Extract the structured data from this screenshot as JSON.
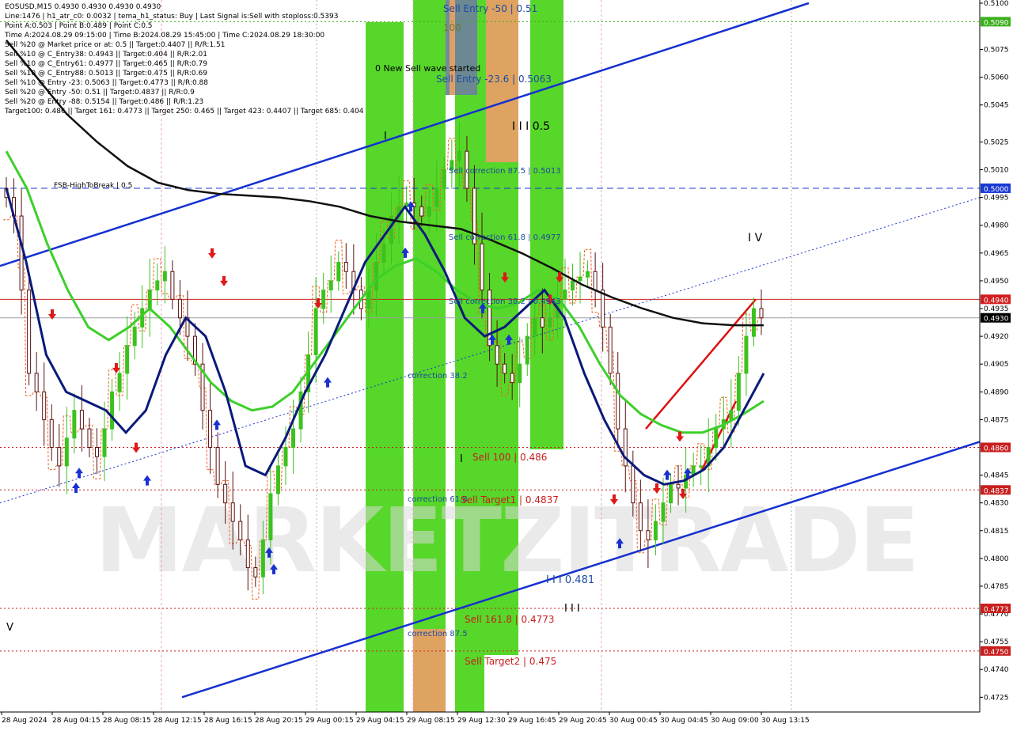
{
  "info_lines": [
    "EOSUSD,M15  0.4930 0.4930 0.4930 0.4930",
    "Line:1476 | h1_atr_c0: 0.0032 | tema_h1_status: Buy | Last Signal is:Sell with stoploss:0.5393",
    "Point A:0.503 | Point B:0.489 | Point C:0.5",
    "Time A:2024.08.29 09:15:00 | Time B:2024.08.29 15:45:00 | Time C:2024.08.29 18:30:00",
    "Sell %20 @ Market price or at: 0.5 || Target:0.4407 || R/R:1.51",
    "Sell %10 @ C_Entry38: 0.4943 || Target:0.404 || R/R:2.01",
    "Sell %10 @ C_Entry61: 0.4977 || Target:0.465 || R/R:0.79",
    "Sell %10 @ C_Entry88: 0.5013 || Target:0.475 || R/R:0.69",
    "Sell %10 @ Entry -23: 0.5063 || Target:0.4773 || R/R:0.88",
    "Sell %20 @ Entry -50: 0.51 || Target:0.4837 || R/R:0.9",
    "Sell %20 @ Entry -88: 0.5154 || Target:0.486 || R/R:1.23",
    "Target100: 0.486 || Target 161: 0.4773 || Target 250: 0.465 || Target 423: 0.4407 || Target 685: 0.404"
  ],
  "watermark": "MARKETZITRADE",
  "colors": {
    "green_zone": "#4ed51d",
    "orange_zone": "#e6a064",
    "gray_zone": "#6d8499",
    "bull_candle": "#3cc21e",
    "bear_candle": "#5a1010",
    "sma_black": "#111111",
    "ma_navy": "#0a1a7a",
    "ma_green": "#3ccf2a",
    "channel_blue": "#1530d0",
    "level_red": "#b32020",
    "stair_orange": "#f06020"
  },
  "chart_data": {
    "type": "candlestick",
    "symbol": "EOSUSD",
    "timeframe": "M15",
    "ylim": [
      0.4723,
      0.51
    ],
    "y_ticks": [
      "0.5100",
      "0.5075",
      "0.5060",
      "0.5045",
      "0.5025",
      "0.5010",
      "0.4995",
      "0.4980",
      "0.4965",
      "0.4950",
      "0.4935",
      "0.4920",
      "0.4905",
      "0.4890",
      "0.4875",
      "0.4860",
      "0.4845",
      "0.4830",
      "0.4815",
      "0.4800",
      "0.4785",
      "0.4770",
      "0.4755",
      "0.4740",
      "0.4725"
    ],
    "x_labels": [
      "28 Aug 2024",
      "28 Aug 04:15",
      "28 Aug 08:15",
      "28 Aug 12:15",
      "28 Aug 16:15",
      "28 Aug 20:15",
      "29 Aug 00:15",
      "29 Aug 04:15",
      "29 Aug 08:15",
      "29 Aug 12:30",
      "29 Aug 16:45",
      "29 Aug 20:45",
      "30 Aug 00:45",
      "30 Aug 04:45",
      "30 Aug 09:00",
      "30 Aug 13:15"
    ],
    "close_path": [
      0.4995,
      0.4985,
      0.4945,
      0.49,
      0.489,
      0.4875,
      0.486,
      0.485,
      0.4865,
      0.488,
      0.487,
      0.486,
      0.4855,
      0.487,
      0.489,
      0.49,
      0.4915,
      0.4925,
      0.4935,
      0.4945,
      0.495,
      0.4955,
      0.494,
      0.493,
      0.492,
      0.4905,
      0.488,
      0.486,
      0.484,
      0.483,
      0.482,
      0.481,
      0.4795,
      0.479,
      0.481,
      0.4835,
      0.485,
      0.486,
      0.487,
      0.489,
      0.491,
      0.4935,
      0.4945,
      0.495,
      0.496,
      0.4955,
      0.4945,
      0.4935,
      0.4945,
      0.496,
      0.497,
      0.4985,
      0.499,
      0.4992,
      0.499,
      0.4985,
      0.499,
      0.5,
      0.501,
      0.5015,
      0.502,
      0.5,
      0.497,
      0.4945,
      0.4915,
      0.4905,
      0.49,
      0.4895,
      0.4905,
      0.492,
      0.493,
      0.4925,
      0.493,
      0.494,
      0.4945,
      0.495,
      0.4952,
      0.4955,
      0.4945,
      0.4925,
      0.49,
      0.487,
      0.485,
      0.483,
      0.4815,
      0.481,
      0.482,
      0.483,
      0.484,
      0.4838,
      0.4845,
      0.485,
      0.485,
      0.486,
      0.487,
      0.4875,
      0.488,
      0.49,
      0.492,
      0.4935,
      0.493
    ],
    "sma_black_path": [
      0.508,
      0.506,
      0.504,
      0.5025,
      0.5012,
      0.5003,
      0.4999,
      0.4997,
      0.4996,
      0.4995,
      0.4993,
      0.499,
      0.4985,
      0.4982,
      0.498,
      0.4978,
      0.4972,
      0.4965,
      0.4957,
      0.4948,
      0.4941,
      0.4935,
      0.493,
      0.4927,
      0.4926,
      0.4926
    ],
    "ma_navy_path": [
      0.5,
      0.496,
      0.491,
      0.489,
      0.4885,
      0.488,
      0.4868,
      0.488,
      0.491,
      0.493,
      0.492,
      0.489,
      0.485,
      0.4845,
      0.4865,
      0.489,
      0.491,
      0.4935,
      0.496,
      0.4975,
      0.499,
      0.4975,
      0.4955,
      0.493,
      0.492,
      0.4925,
      0.4935,
      0.4945,
      0.493,
      0.49,
      0.4875,
      0.4855,
      0.4845,
      0.484,
      0.4842,
      0.4848,
      0.486,
      0.488,
      0.49
    ],
    "ma_green_path": [
      0.502,
      0.5,
      0.497,
      0.4945,
      0.4925,
      0.4918,
      0.4925,
      0.4935,
      0.4925,
      0.491,
      0.4895,
      0.4885,
      0.488,
      0.4882,
      0.489,
      0.4905,
      0.492,
      0.4935,
      0.495,
      0.4958,
      0.4962,
      0.4955,
      0.4945,
      0.4938,
      0.4935,
      0.4938,
      0.4945,
      0.494,
      0.4925,
      0.4905,
      0.4888,
      0.4878,
      0.4872,
      0.4868,
      0.4868,
      0.4872,
      0.4878,
      0.4885
    ],
    "horizontal_levels": [
      {
        "label": "0.5090",
        "value": 0.509,
        "style": "green-dotted",
        "tag_color": "#3cb01e"
      },
      {
        "label": "0.5000",
        "value": 0.5,
        "style": "blue-dashed",
        "tag_color": "#1a3ad6"
      },
      {
        "label": "0.4940",
        "value": 0.494,
        "style": "red-solid",
        "tag_color": "#d21e1e"
      },
      {
        "label": "0.4930",
        "value": 0.493,
        "style": "gray-solid",
        "tag_color": "#000000"
      },
      {
        "label": "0.4860",
        "value": 0.486,
        "style": "red-dotted",
        "tag_color": "#c81e1e"
      },
      {
        "label": "0.4837",
        "value": 0.4837,
        "style": "red-dotted",
        "tag_color": "#c81e1e"
      },
      {
        "label": "0.4773",
        "value": 0.4773,
        "style": "red-dotted",
        "tag_color": "#c81e1e"
      },
      {
        "label": "0.4750",
        "value": 0.475,
        "style": "red-dotted",
        "tag_color": "#c81e1e"
      }
    ],
    "annotations": [
      {
        "text": "Sell Entry -50 | 0.51",
        "value": 0.5098,
        "color": "#1e4aa0",
        "anchor": "sell-entry-50"
      },
      {
        "text": "100",
        "value": 0.506,
        "color": "#6f7a30",
        "anchor": "level-100"
      },
      {
        "text": "0 New Sell wave started",
        "value": 0.5055,
        "color": "#000000",
        "anchor": "new-sell-wave"
      },
      {
        "text": "Sell Entry -23.6 | 0.5063",
        "value": 0.5047,
        "color": "#1e4aa0",
        "anchor": "sell-entry-236"
      },
      {
        "text": "I I I 0.5",
        "value": 0.5033,
        "color": "#000000",
        "anchor": "wave-iii-05"
      },
      {
        "text": "I",
        "value": 0.5027,
        "color": "#000000",
        "anchor": "wave-i"
      },
      {
        "text": "Sell correction 87.5 | 0.5013",
        "value": 0.5013,
        "color": "#1e4aa0",
        "anchor": "sell-corr-875"
      },
      {
        "text": "FSB-HighToBreak | 0.5",
        "value": 0.5002,
        "color": "#000000",
        "anchor": "fsb-high"
      },
      {
        "text": "Sell correction 61.8 | 0.4977",
        "value": 0.4976,
        "color": "#1e4aa0",
        "anchor": "sell-corr-618"
      },
      {
        "text": "I V",
        "value": 0.4976,
        "color": "#000000",
        "anchor": "wave-iv"
      },
      {
        "text": "Sell correction 38.2 | 0.4943",
        "value": 0.494,
        "color": "#1e4aa0",
        "anchor": "sell-corr-382"
      },
      {
        "text": "correction 38.2",
        "value": 0.4897,
        "color": "#1e4aa0",
        "anchor": "corr-382"
      },
      {
        "text": "I",
        "value": 0.4856,
        "color": "#000000",
        "anchor": "wave-i-low"
      },
      {
        "text": "Sell 100 | 0.486",
        "value": 0.4856,
        "color": "#c81e1e",
        "anchor": "sell-100"
      },
      {
        "text": "correction 61.8",
        "value": 0.4832,
        "color": "#1e4aa0",
        "anchor": "corr-618"
      },
      {
        "text": "Sell Target1 | 0.4837",
        "value": 0.4831,
        "color": "#c81e1e",
        "anchor": "sell-target1"
      },
      {
        "text": "I I I 0.481",
        "value": 0.4791,
        "color": "#1e4aa0",
        "anchor": "wave-iii-0481"
      },
      {
        "text": "I I I",
        "value": 0.4775,
        "color": "#000000",
        "anchor": "wave-iii"
      },
      {
        "text": "V",
        "value": 0.4767,
        "color": "#000000",
        "anchor": "wave-v"
      },
      {
        "text": "Sell 161.8 | 0.4773",
        "value": 0.4768,
        "color": "#c81e1e",
        "anchor": "sell-1618"
      },
      {
        "text": "correction 87.5",
        "value": 0.4762,
        "color": "#1e4aa0",
        "anchor": "corr-875"
      },
      {
        "text": "Sell Target2 | 0.475",
        "value": 0.4745,
        "color": "#c81e1e",
        "anchor": "sell-target2"
      }
    ]
  }
}
